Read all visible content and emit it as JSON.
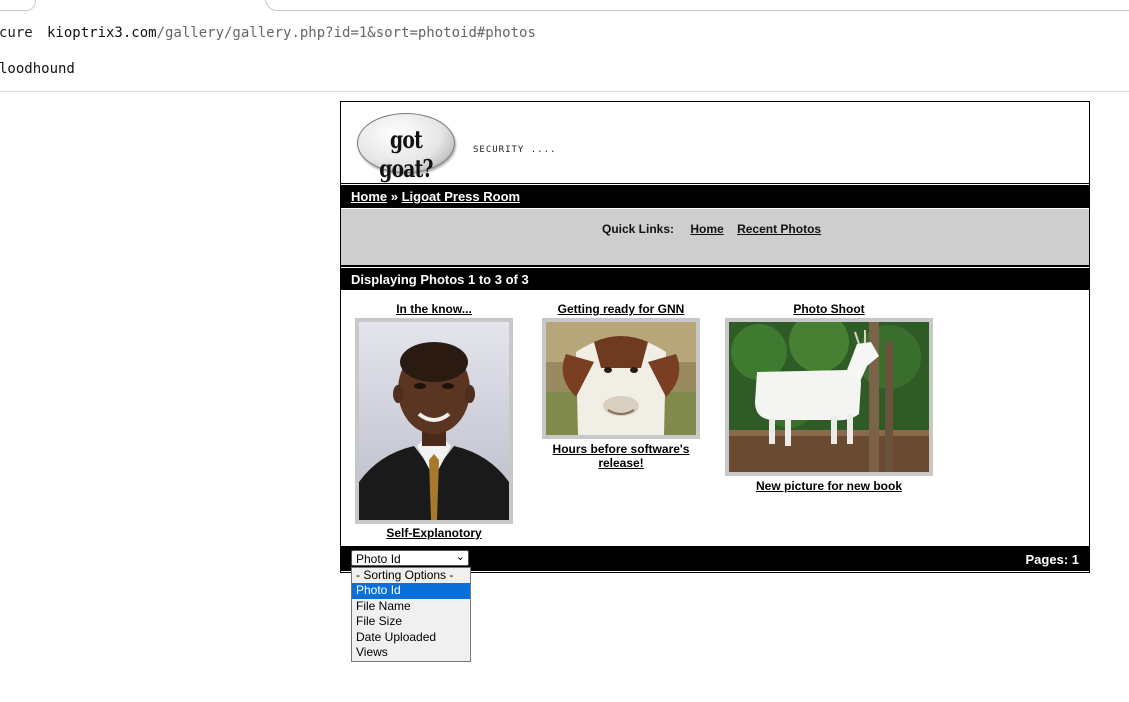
{
  "browser": {
    "secure_label": "cure",
    "url_host": "kioptrix3.com",
    "url_path": "/gallery/gallery.php?id=1&sort=photoid#photos",
    "bookmark": "loodhound"
  },
  "site": {
    "logo_text": "got goat?",
    "tagline": "SECURITY ....",
    "breadcrumb_home": "Home",
    "breadcrumb_sep": "»",
    "breadcrumb_current": "Ligoat Press Room",
    "quick_links_label": "Quick Links:",
    "quick_links": [
      "Home",
      "Recent Photos"
    ],
    "count_text": "Displaying Photos 1 to 3 of 3",
    "pages_text": "Pages: 1"
  },
  "photos": [
    {
      "title": "In the know...",
      "caption": "Self-Explanotory",
      "image": "man-in-suit-photo"
    },
    {
      "title": "Getting ready for GNN",
      "caption": "Hours before software's release!",
      "image": "goat-closeup-photo"
    },
    {
      "title": "Photo Shoot",
      "caption": "New picture for new book",
      "image": "white-goat-photo"
    }
  ],
  "sort": {
    "selected": "Photo Id",
    "options": [
      "- Sorting Options -",
      "Photo Id",
      "File Name",
      "File Size",
      "Date Uploaded",
      "Views"
    ]
  }
}
